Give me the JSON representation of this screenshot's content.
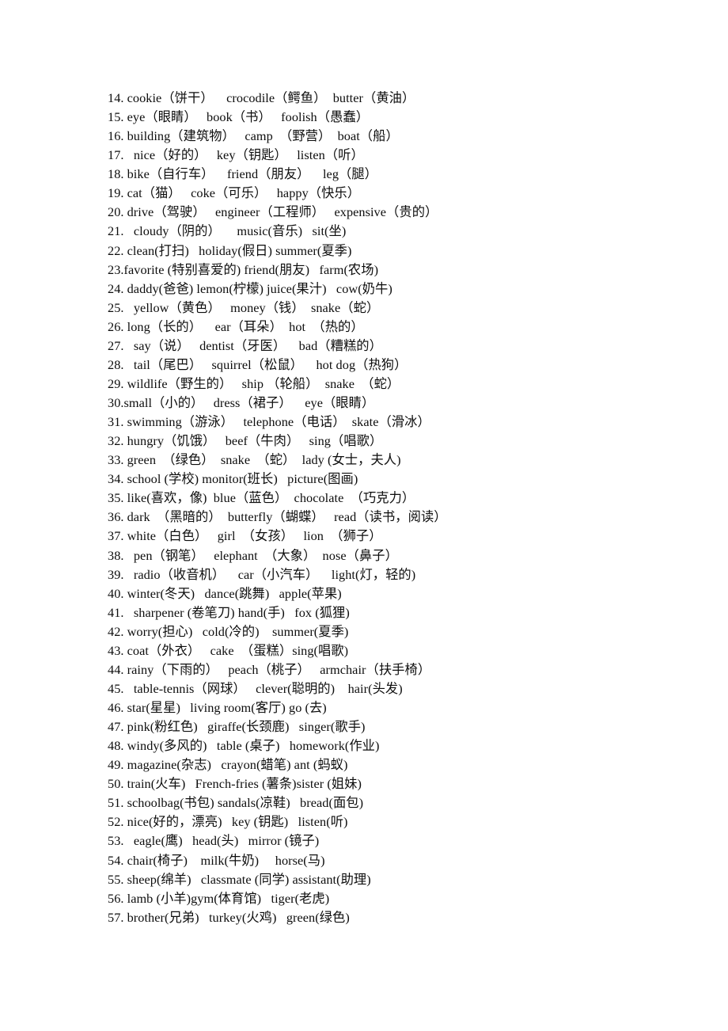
{
  "document": {
    "type": "vocabulary-word-list",
    "language_pair": "English-Chinese",
    "background_color": "#ffffff",
    "text_color": "#0d0d0d",
    "lines": [
      {
        "number": "14.",
        "text": "14. cookie（饼干）    crocodile（鳄鱼）  butter（黄油）"
      },
      {
        "number": "15.",
        "text": "15. eye（眼睛）   book（书）   foolish（愚蠢）"
      },
      {
        "number": "16.",
        "text": "16. building（建筑物）   camp  （野营）  boat（船）"
      },
      {
        "number": "17.",
        "text": "17.   nice（好的）   key（钥匙）   listen（听）"
      },
      {
        "number": "18.",
        "text": "18. bike（自行车）    friend（朋友）    leg（腿）"
      },
      {
        "number": "19.",
        "text": "19. cat（猫）   coke（可乐）   happy（快乐）"
      },
      {
        "number": "20.",
        "text": "20. drive（驾驶）   engineer（工程师）   expensive（贵的）"
      },
      {
        "number": "21.",
        "text": "21.   cloudy（阴的）     music(音乐)   sit(坐)"
      },
      {
        "number": "22.",
        "text": "22. clean(打扫)   holiday(假日) summer(夏季)"
      },
      {
        "number": "23.",
        "text": "23.favorite (特别喜爱的) friend(朋友)   farm(农场)"
      },
      {
        "number": "24.",
        "text": "24. daddy(爸爸) lemon(柠檬) juice(果汁)   cow(奶牛)"
      },
      {
        "number": "25.",
        "text": "25.   yellow（黄色）   money（钱）  snake（蛇）"
      },
      {
        "number": "26.",
        "text": "26. long（长的）    ear（耳朵）  hot  （热的）"
      },
      {
        "number": "27.",
        "text": "27.   say（说）   dentist（牙医）    bad（糟糕的）"
      },
      {
        "number": "28.",
        "text": "28.   tail（尾巴）   squirrel（松鼠）    hot dog（热狗）"
      },
      {
        "number": "29.",
        "text": "29. wildlife（野生的）   ship （轮船）  snake  （蛇）"
      },
      {
        "number": "30.",
        "text": "30.small（小的）   dress（裙子）    eye（眼睛）"
      },
      {
        "number": "31.",
        "text": "31. swimming（游泳）   telephone（电话）  skate（滑冰）"
      },
      {
        "number": "32.",
        "text": "32. hungry（饥饿）   beef（牛肉）   sing（唱歌）"
      },
      {
        "number": "33.",
        "text": "33. green  （绿色）  snake  （蛇）  lady (女士，夫人)"
      },
      {
        "number": "34.",
        "text": "34. school (学校) monitor(班长)   picture(图画)"
      },
      {
        "number": "35.",
        "text": "35. like(喜欢，像)  blue（蓝色）  chocolate  （巧克力）"
      },
      {
        "number": "36.",
        "text": "36. dark  （黑暗的）  butterfly（蝴蝶）   read（读书，阅读）"
      },
      {
        "number": "37.",
        "text": "37. white（白色）   girl  （女孩）   lion  （狮子）"
      },
      {
        "number": "38.",
        "text": "38.   pen（钢笔）   elephant  （大象）  nose（鼻子）"
      },
      {
        "number": "39.",
        "text": "39.   radio（收音机）    car（小汽车）    light(灯，轻的)"
      },
      {
        "number": "40.",
        "text": "40. winter(冬天)   dance(跳舞)   apple(苹果)"
      },
      {
        "number": "41.",
        "text": "41.   sharpener (卷笔刀) hand(手)   fox (狐狸)"
      },
      {
        "number": "42.",
        "text": "42. worry(担心)   cold(冷的)    summer(夏季)"
      },
      {
        "number": "43.",
        "text": "43. coat（外衣）   cake  （蛋糕）sing(唱歌)"
      },
      {
        "number": "44.",
        "text": "44. rainy（下雨的）   peach（桃子）   armchair（扶手椅）"
      },
      {
        "number": "45.",
        "text": "45.   table-tennis（网球）   clever(聪明的)    hair(头发)"
      },
      {
        "number": "46.",
        "text": "46. star(星星)   living room(客厅) go (去)"
      },
      {
        "number": "47.",
        "text": "47. pink(粉红色)   giraffe(长颈鹿)   singer(歌手)"
      },
      {
        "number": "48.",
        "text": "48. windy(多风的)   table (桌子)   homework(作业)"
      },
      {
        "number": "49.",
        "text": "49. magazine(杂志)   crayon(蜡笔) ant (蚂蚁)"
      },
      {
        "number": "50.",
        "text": "50. train(火车)   French-fries (薯条)sister (姐妹)"
      },
      {
        "number": "51.",
        "text": "51. schoolbag(书包) sandals(凉鞋)   bread(面包)"
      },
      {
        "number": "52.",
        "text": "52. nice(好的，漂亮)   key (钥匙)   listen(听)"
      },
      {
        "number": "53.",
        "text": "53.   eagle(鹰)   head(头)   mirror (镜子)"
      },
      {
        "number": "54.",
        "text": "54. chair(椅子)    milk(牛奶)     horse(马)"
      },
      {
        "number": "55.",
        "text": "55. sheep(绵羊)   classmate (同学) assistant(助理)"
      },
      {
        "number": "56.",
        "text": "56. lamb (小羊)gym(体育馆)   tiger(老虎)"
      },
      {
        "number": "57.",
        "text": "57. brother(兄弟)   turkey(火鸡)   green(绿色)"
      }
    ]
  }
}
